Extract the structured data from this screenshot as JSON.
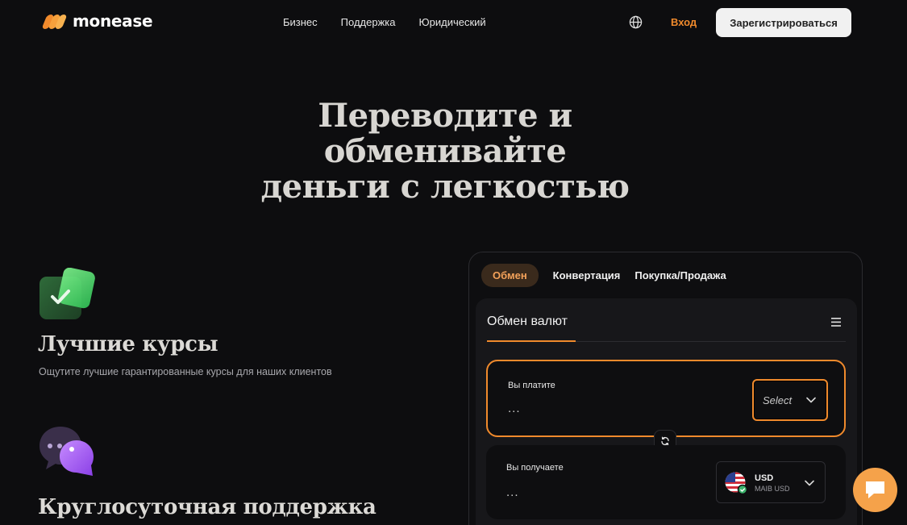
{
  "brand": {
    "name": "monease"
  },
  "nav": {
    "items": [
      "Бизнес",
      "Поддержка",
      "Юридический"
    ]
  },
  "header": {
    "login": "Вход",
    "register": "Зарегистрироваться"
  },
  "hero": {
    "lines": [
      "Переводите и",
      "обменивайте",
      "деньги с легкостью"
    ]
  },
  "features": [
    {
      "title": "Лучшие курсы",
      "description": "Ощутите лучшие гарантированные курсы для наших клиентов"
    },
    {
      "title": "Круглосуточная поддержка"
    }
  ],
  "widget": {
    "tabs": [
      "Обмен",
      "Конвертация",
      "Покупка/Продажа"
    ],
    "active_tab": "Обмен",
    "panel_title": "Обмен валют",
    "pay": {
      "label": "Вы платите",
      "value": "...",
      "select_label": "Select"
    },
    "receive": {
      "label": "Вы получаете",
      "value": "...",
      "currency_code": "USD",
      "currency_sub": "MAIB USD"
    }
  },
  "colors": {
    "accent": "#f08a2c",
    "background": "#0d0d0f",
    "panel": "#17171a"
  }
}
